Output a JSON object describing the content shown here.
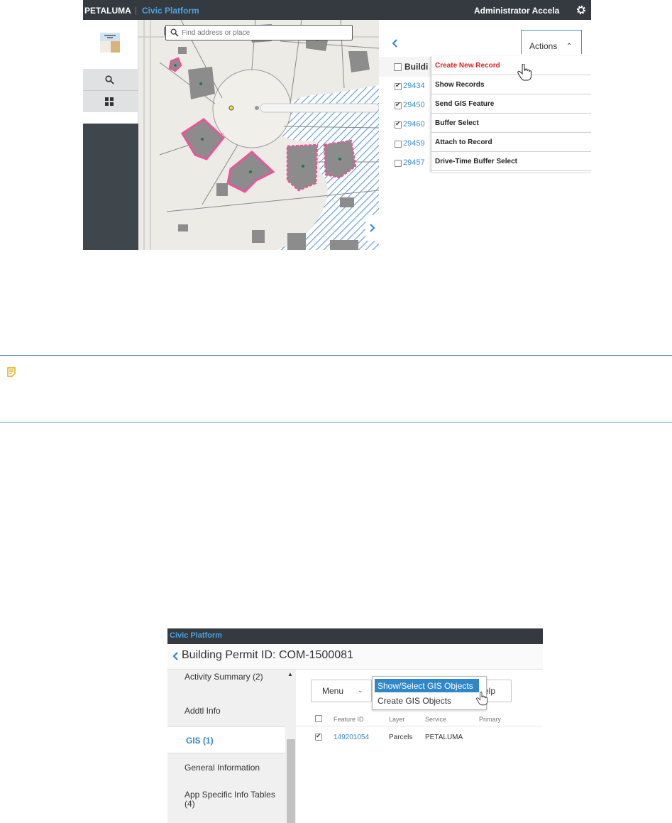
{
  "screenshot1": {
    "topbar": {
      "brand": "PETALUMA",
      "separator": "|",
      "platform": "Civic Platform",
      "user": "Administrator Accela"
    },
    "map_search": {
      "placeholder": "Find address or place"
    },
    "panel": {
      "column_header": "Buildi",
      "actions_label": "Actions",
      "records": [
        {
          "id": "29434",
          "checked": true
        },
        {
          "id": "29450",
          "checked": true
        },
        {
          "id": "29460",
          "checked": true
        },
        {
          "id": "29459",
          "checked": false
        },
        {
          "id": "29457",
          "checked": false
        }
      ]
    },
    "actions_menu": [
      {
        "label": "Create New Record",
        "active": true
      },
      {
        "label": "Show Records"
      },
      {
        "label": "Send GIS Feature"
      },
      {
        "label": "Buffer Select"
      },
      {
        "label": "Attach to Record"
      },
      {
        "label": "Drive-Time Buffer Select"
      }
    ],
    "icons": [
      "gear-icon",
      "layers-icon",
      "search-icon",
      "grid-icon",
      "chevron-left-icon",
      "chevron-right-icon",
      "hand-cursor-icon"
    ]
  },
  "note": {
    "icon": "note-icon"
  },
  "screenshot2": {
    "topbar": {
      "platform": "Civic Platform"
    },
    "title": "Building Permit ID: COM-1500081",
    "sidebar": [
      {
        "label": "Activity Summary (2)"
      },
      {
        "label": "Addtl Info"
      },
      {
        "label": "GIS (1)",
        "active": true
      },
      {
        "label": "General Information"
      },
      {
        "label": "App Specific Info Tables (4)"
      }
    ],
    "menu_button": "Menu",
    "help_button": "elp",
    "dropdown": {
      "selected": "Show/Select GIS Objects",
      "other": "Create GIS Objects"
    },
    "table": {
      "headers": [
        "Feature ID",
        "Layer",
        "Service",
        "Primary"
      ],
      "rows": [
        {
          "checked": true,
          "feature_id": "149201054",
          "layer": "Parcels",
          "service": "PETALUMA",
          "primary": ""
        }
      ]
    }
  }
}
